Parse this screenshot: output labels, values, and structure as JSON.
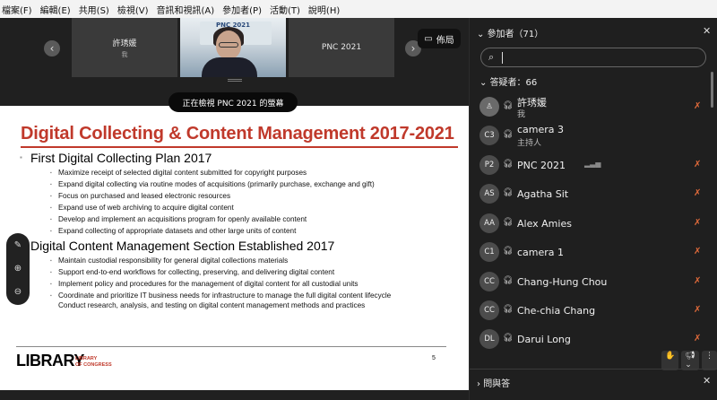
{
  "menu": [
    "檔案(F)",
    "編輯(E)",
    "共用(S)",
    "檢視(V)",
    "音訊和視訊(A)",
    "參加者(P)",
    "活動(T)",
    "說明(H)"
  ],
  "strip": {
    "tiles": [
      {
        "name": "許琇媛",
        "sub": "我"
      },
      {
        "name": "PNC 2021",
        "sub": ""
      }
    ],
    "video_banner": "PNC 2021",
    "layout_label": "佈局"
  },
  "share_status": "正在檢視 PNC 2021 的螢幕",
  "slide": {
    "title": "Digital Collecting & Content Management 2017-2021",
    "section1": "First Digital Collecting Plan 2017",
    "bullets1": [
      "Maximize receipt of selected digital content submitted for copyright purposes",
      "Expand digital collecting via routine modes of acquisitions (primarily purchase, exchange and gift)",
      "Focus on purchased and leased electronic resources",
      "Expand use of web archiving to acquire digital content",
      "Develop and implement an acquisitions program for openly available content",
      "Expand collecting of appropriate datasets and other large units of content"
    ],
    "section2": "Digital Content Management Section Established 2017",
    "bullets2": [
      "Maintain custodial responsibility for general digital collections materials",
      "Support  end-to-end workflows  for collecting, preserving, and delivering digital content",
      "Implement policy and procedures for the management of digital content for all custodial units",
      "Coordinate and prioritize IT business needs for infrastructure to manage the full digital content lifecycle",
      "Conduct research, analysis, and testing on digital content management methods and practices"
    ],
    "logo": "LIBRARY",
    "logo_sub1": "LIBRARY",
    "logo_sub2": "OF CONGRESS",
    "page": "5"
  },
  "panel": {
    "title": "參加者（71）",
    "section": "答疑者：66",
    "participants": [
      {
        "initials": "",
        "name": "許琇媛",
        "role": "我",
        "muted": true
      },
      {
        "initials": "C3",
        "name": "camera 3",
        "role": "主持人",
        "muted": false
      },
      {
        "initials": "P2",
        "name": "PNC 2021",
        "role": "",
        "muted": true
      },
      {
        "initials": "AS",
        "name": "Agatha Sit",
        "role": "",
        "muted": true
      },
      {
        "initials": "AA",
        "name": "Alex Amies",
        "role": "",
        "muted": true
      },
      {
        "initials": "C1",
        "name": "camera 1",
        "role": "",
        "muted": true
      },
      {
        "initials": "CC",
        "name": "Chang-Hung Chou",
        "role": "",
        "muted": true
      },
      {
        "initials": "CC",
        "name": "Che-chia Chang",
        "role": "",
        "muted": true
      },
      {
        "initials": "DL",
        "name": "Darui Long",
        "role": "",
        "muted": true
      }
    ],
    "qa_label": "問與答"
  }
}
